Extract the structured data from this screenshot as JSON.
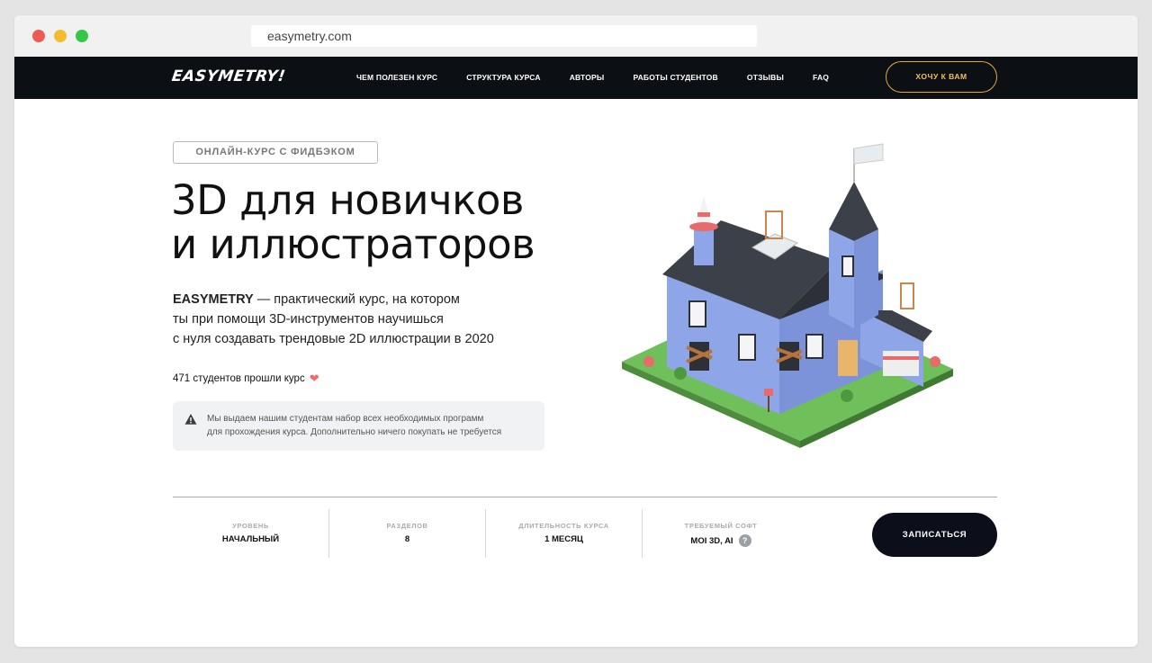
{
  "browser": {
    "url": "easymetry.com"
  },
  "nav": {
    "logo": "EASYMETRY!",
    "links": [
      "ЧЕМ ПОЛЕЗЕН КУРС",
      "СТРУКТУРА КУРСА",
      "АВТОРЫ",
      "РАБОТЫ СТУДЕНТОВ",
      "ОТЗЫВЫ",
      "FAQ"
    ],
    "cta": "ХОЧУ К ВАМ"
  },
  "hero": {
    "badge": "ОНЛАЙН-КУРС С ФИДБЭКОМ",
    "title_line1": "3D для новичков",
    "title_line2": "и иллюстраторов",
    "desc_brand": "EASYMETRY",
    "desc_line1": " — практический курс, на котором",
    "desc_line2": "ты при помощи 3D-инструментов научишься",
    "desc_line3": "с нуля создавать трендовые 2D иллюстрации в 2020",
    "students": "471 студентов прошли курс",
    "note_line1": "Мы выдаем нашим студентам набор всех необходимых программ",
    "note_line2": "для прохождения курса. Дополнительно ничего покупать не требуется"
  },
  "stats": [
    {
      "label": "УРОВЕНЬ",
      "value": "НАЧАЛЬНЫЙ"
    },
    {
      "label": "РАЗДЕЛОВ",
      "value": "8"
    },
    {
      "label": "ДЛИТЕЛЬНОСТЬ КУРСА",
      "value": "1 МЕСЯЦ"
    },
    {
      "label": "ТРЕБУЕМЫЙ СОФТ",
      "value": "MOI 3D, AI",
      "help": "?"
    }
  ],
  "enroll": "ЗАПИСАТЬСЯ",
  "colors": {
    "nav_bg": "#0c0f14",
    "cta_border": "#e0a840",
    "heart": "#f06b6b",
    "house_wall": "#8ea6e8",
    "roof": "#3c4048"
  }
}
